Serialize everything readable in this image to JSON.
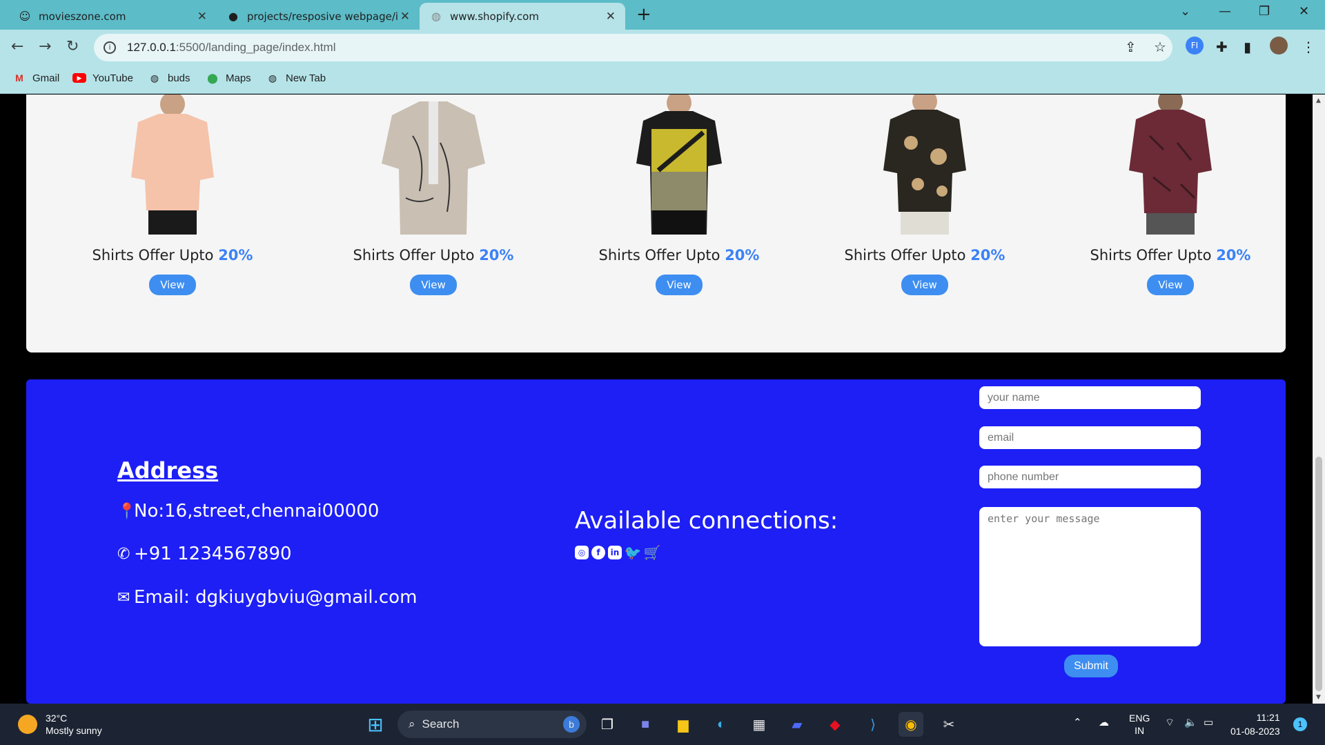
{
  "browser": {
    "tabs": [
      {
        "title": "movieszone.com",
        "icon": "smiley-icon"
      },
      {
        "title": "projects/resposive webpage/inde",
        "icon": "github-icon"
      },
      {
        "title": "www.shopify.com",
        "icon": "globe-icon"
      }
    ],
    "url_host": "127.0.0.1",
    "url_rest": ":5500/landing_page/index.html",
    "bookmarks": [
      {
        "label": "Gmail",
        "icon": "gmail-icon"
      },
      {
        "label": "YouTube",
        "icon": "youtube-icon"
      },
      {
        "label": "buds",
        "icon": "globe-icon"
      },
      {
        "label": "Maps",
        "icon": "maps-icon"
      },
      {
        "label": "New Tab",
        "icon": "globe-icon"
      }
    ],
    "profile_initials": "FI"
  },
  "products": [
    {
      "title": "Shirts Offer Upto ",
      "discount": "20%",
      "button": "View",
      "shirt_color": "#f4c3aa"
    },
    {
      "title": "Shirts Offer Upto ",
      "discount": "20%",
      "button": "View",
      "shirt_color": "#c9bfb3"
    },
    {
      "title": "Shirts Offer Upto ",
      "discount": "20%",
      "button": "View",
      "shirt_color": "#8d8b6a"
    },
    {
      "title": "Shirts Offer Upto ",
      "discount": "20%",
      "button": "View",
      "shirt_color": "#2a2620"
    },
    {
      "title": "Shirts Offer Upto ",
      "discount": "20%",
      "button": "View",
      "shirt_color": "#6b2a36"
    }
  ],
  "footer": {
    "address_title": "Address",
    "address": "No:16,street,chennai00000",
    "phone": "+91 1234567890",
    "email": "Email: dgkiuygbviu@gmail.com",
    "connections_title": "Available connections:",
    "social_icons": [
      "instagram-icon",
      "facebook-icon",
      "linkedin-icon",
      "twitter-icon",
      "cart-icon"
    ],
    "form": {
      "name_placeholder": "your name",
      "email_placeholder": "email",
      "phone_placeholder": "phone number",
      "message_placeholder": "enter your message",
      "submit": "Submit"
    },
    "accent": "#1d1ff5"
  },
  "taskbar": {
    "temperature": "32°C",
    "weather": "Mostly sunny",
    "search": "Search",
    "lang": "ENG",
    "region": "IN",
    "time": "11:21",
    "date": "01-08-2023",
    "notifications": "1"
  }
}
